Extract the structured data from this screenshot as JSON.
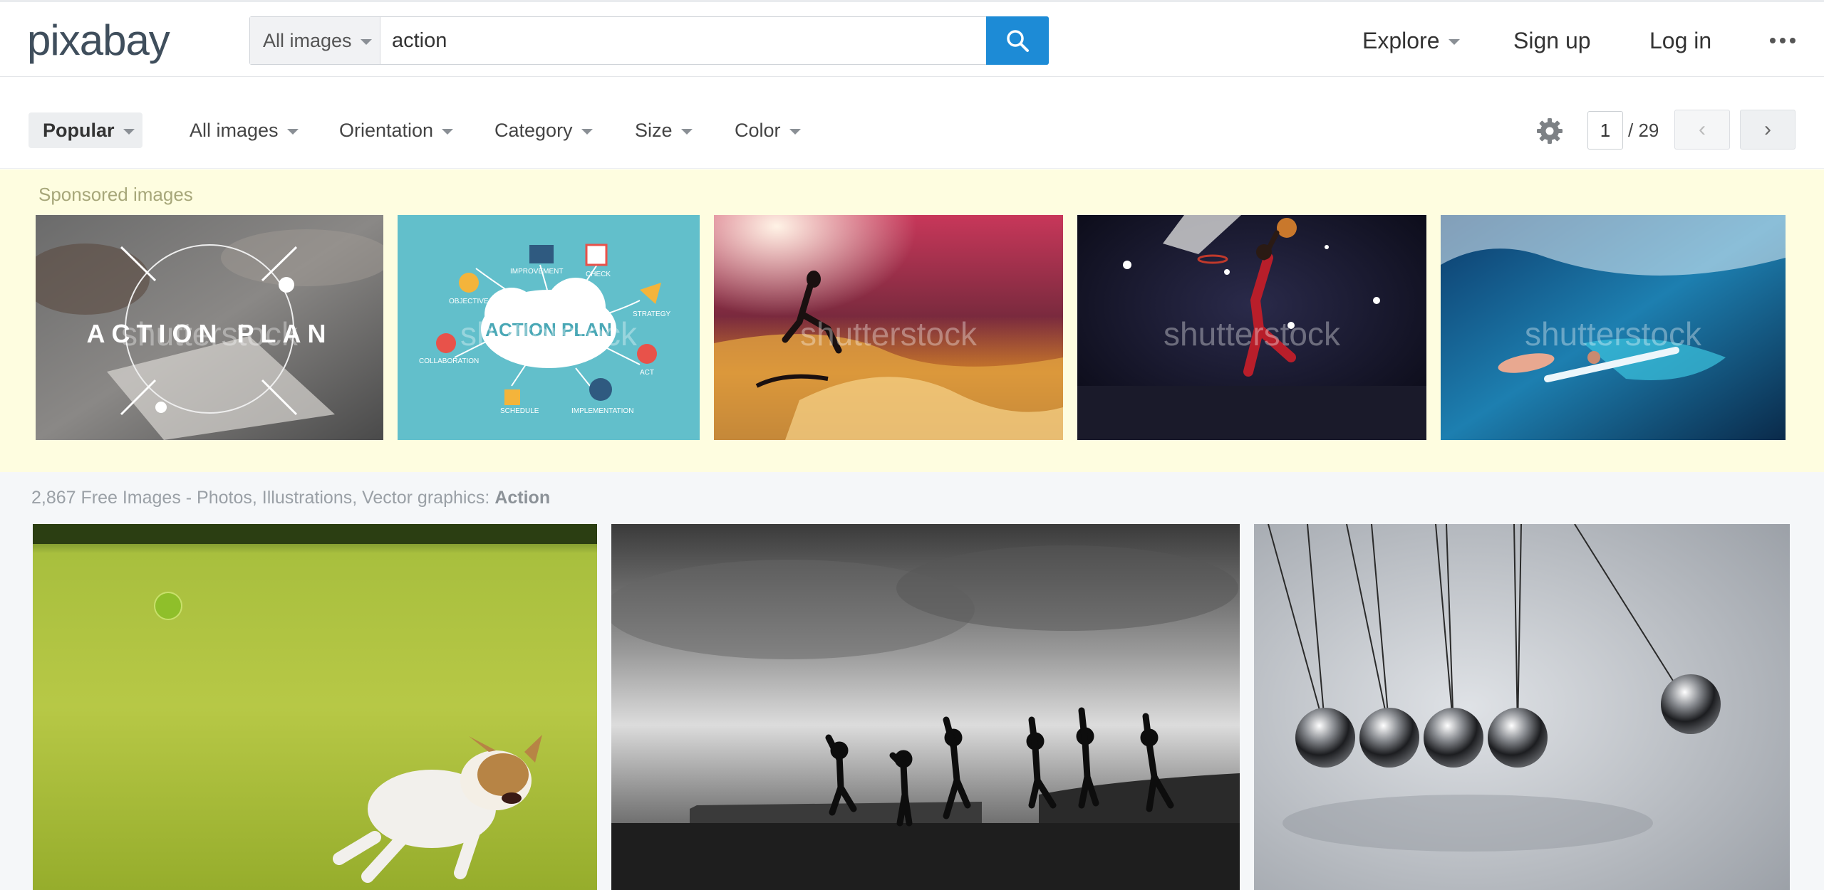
{
  "header": {
    "logo": "pixabay",
    "search_type": "All images",
    "search_value": "action",
    "nav": {
      "explore": "Explore",
      "signup": "Sign up",
      "login": "Log in"
    }
  },
  "filters": {
    "popular": "Popular",
    "all_images": "All images",
    "orientation": "Orientation",
    "category": "Category",
    "size": "Size",
    "color": "Color"
  },
  "pagination": {
    "current": "1",
    "total": "/ 29",
    "prev": "‹",
    "next": "›"
  },
  "sponsored": {
    "label": "Sponsored images",
    "items": [
      {
        "title": "ACTION PLAN",
        "watermark": "shutterstock"
      },
      {
        "title": "ACTION PLAN",
        "watermark": "shutterstock",
        "words": [
          "IMPROVEMENT",
          "CHECK",
          "OBJECTIVE",
          "STRATEGY",
          "COLLABORATION",
          "ACT",
          "SCHEDULE",
          "IMPLEMENTATION"
        ]
      },
      {
        "watermark": "shutterstock"
      },
      {
        "watermark": "shutterstock"
      },
      {
        "watermark": "shutterstock"
      }
    ]
  },
  "results": {
    "label_prefix": "2,867 Free Images - Photos, Illustrations, Vector graphics: ",
    "label_term": "Action"
  },
  "colors": {
    "accent": "#1d8bd6",
    "sponsored_bg": "#fefde0"
  },
  "icons": [
    "search-icon",
    "gear-icon",
    "chevron-left-icon",
    "chevron-right-icon",
    "more-icon"
  ]
}
